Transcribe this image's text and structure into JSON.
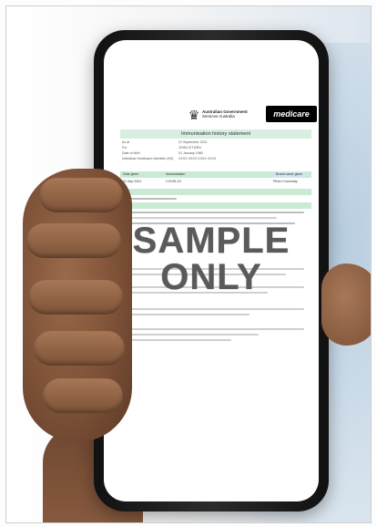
{
  "statement": {
    "agency": "Australian Government",
    "agency_sub": "Services Australia",
    "brand": "medicare",
    "title": "Immunisation history statement",
    "meta": [
      {
        "key": "As at",
        "value": "21 September 2021"
      },
      {
        "key": "For",
        "value": "JOHN CITIZEN"
      },
      {
        "key": "Date of birth",
        "value": "01 January 1980"
      },
      {
        "key": "Individual Healthcare Identifier (IHI)",
        "value": "XXXX XXXX XXXX XXXX"
      }
    ],
    "table_header": {
      "col1": "Date given",
      "col2": "Immunisation",
      "col3": "Brand name given"
    },
    "table_row": {
      "col1": "01 Sep 2021",
      "col2": "COVID-19",
      "col3": "Pfizer Comirnaty"
    },
    "watermark_line1": "SAMPLE",
    "watermark_line2": "ONLY"
  },
  "colors": {
    "band_green": "#c9ead3",
    "band_blue": "#cfe6ef",
    "medicare_black": "#000000",
    "skin": "#8a5c40"
  },
  "icons": [
    "coat-of-arms-icon"
  ]
}
